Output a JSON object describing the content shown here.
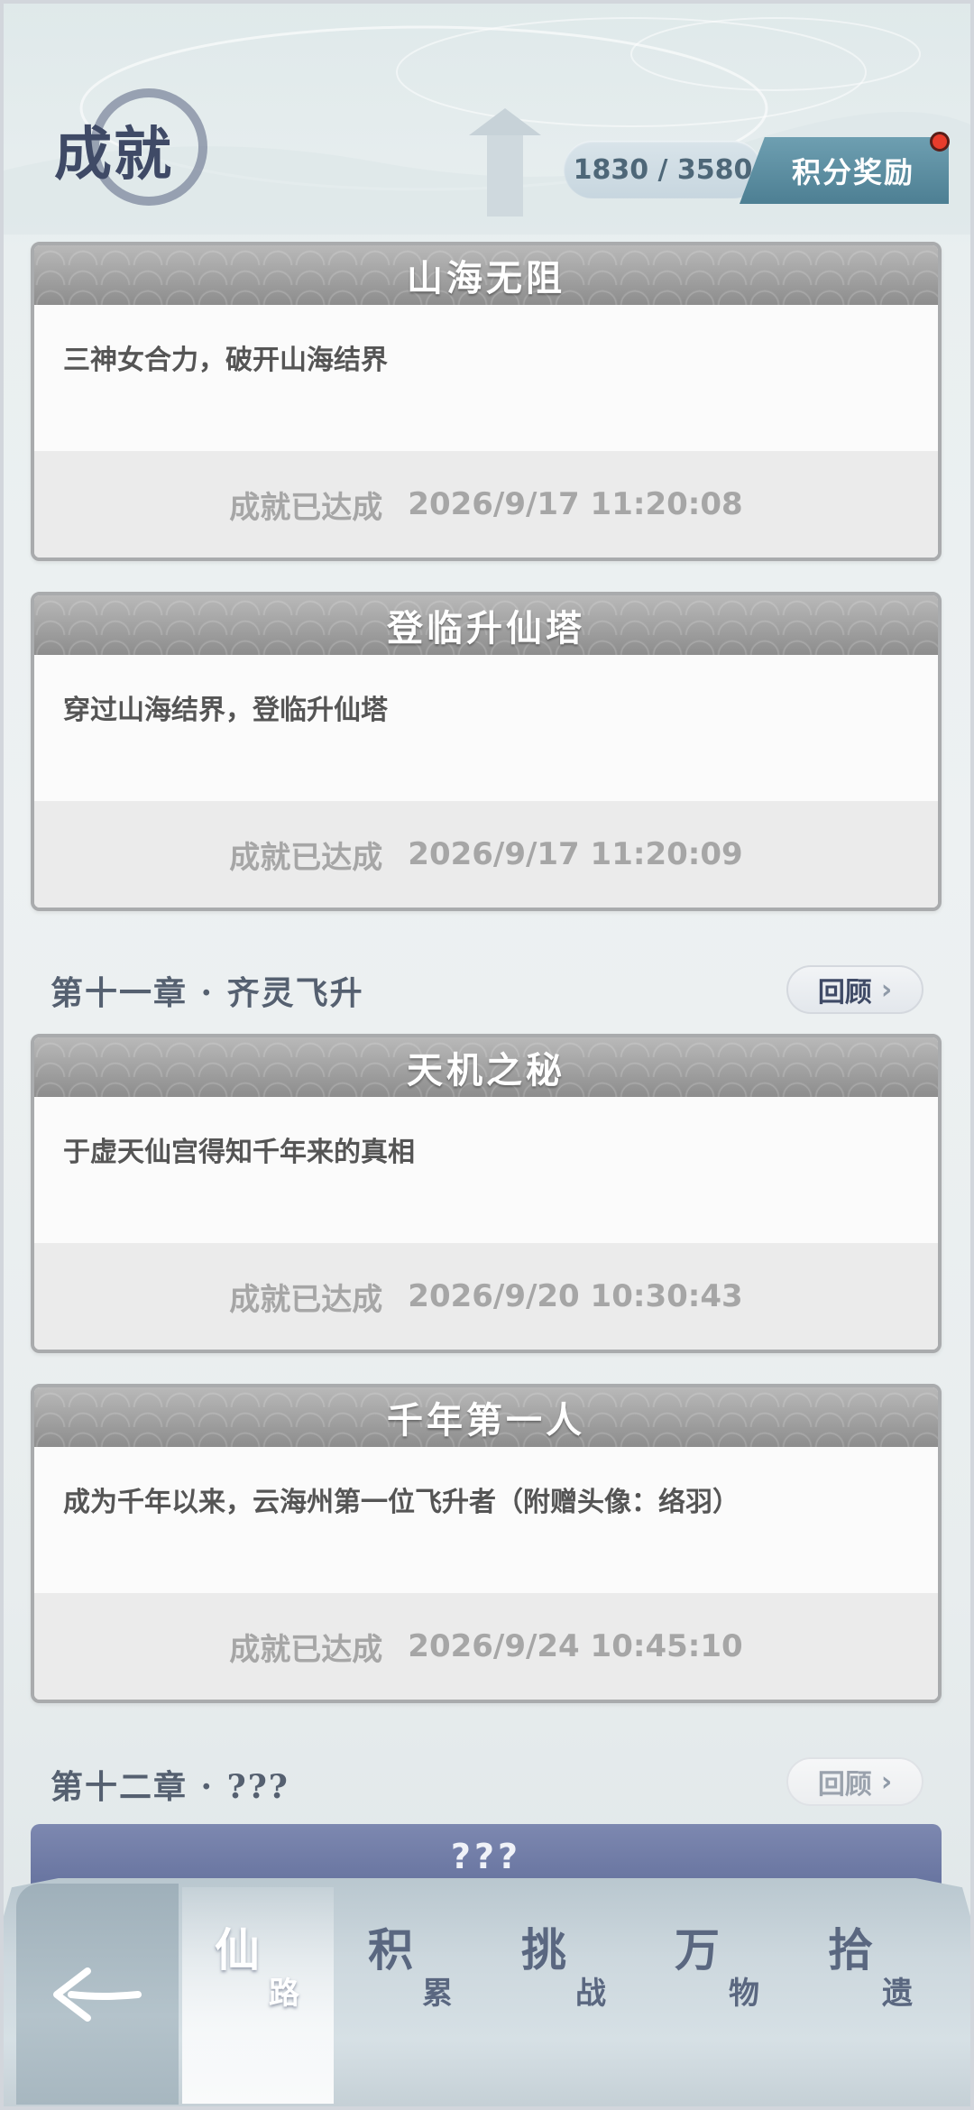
{
  "header": {
    "title": "成就",
    "score": "1830 / 3580",
    "reward_button": "积分奖励"
  },
  "achievements_top": [
    {
      "title": "山海无阻",
      "desc": "三神女合力，破开山海结界",
      "status": "成就已达成",
      "time": "2026/9/17 11:20:08"
    },
    {
      "title": "登临升仙塔",
      "desc": "穿过山海结界，登临升仙塔",
      "status": "成就已达成",
      "time": "2026/9/17 11:20:09"
    }
  ],
  "chapter11": {
    "title": "第十一章 · 齐灵飞升",
    "review": "回顾",
    "achievements": [
      {
        "title": "天机之秘",
        "desc": "于虚天仙宫得知千年来的真相",
        "status": "成就已达成",
        "time": "2026/9/20 10:30:43"
      },
      {
        "title": "千年第一人",
        "desc": "成为千年以来，云海州第一位飞升者（附赠头像：络羽）",
        "status": "成就已达成",
        "time": "2026/9/24 10:45:10"
      }
    ]
  },
  "chapter12": {
    "title": "第十二章 · ???",
    "review": "回顾",
    "locked_title": "???"
  },
  "nav": {
    "tabs": [
      {
        "main": "仙",
        "sub": "路",
        "active": true
      },
      {
        "main": "积",
        "sub": "累",
        "active": false
      },
      {
        "main": "挑",
        "sub": "战",
        "active": false
      },
      {
        "main": "万",
        "sub": "物",
        "active": false
      },
      {
        "main": "拾",
        "sub": "遗",
        "active": false
      }
    ],
    "back_icon": "back-arrow-icon"
  },
  "colors": {
    "accent": "#4d7f93",
    "title": "#3f4a66",
    "badge_dot": "#e83c2c",
    "locked_card": "#6a76a3"
  }
}
